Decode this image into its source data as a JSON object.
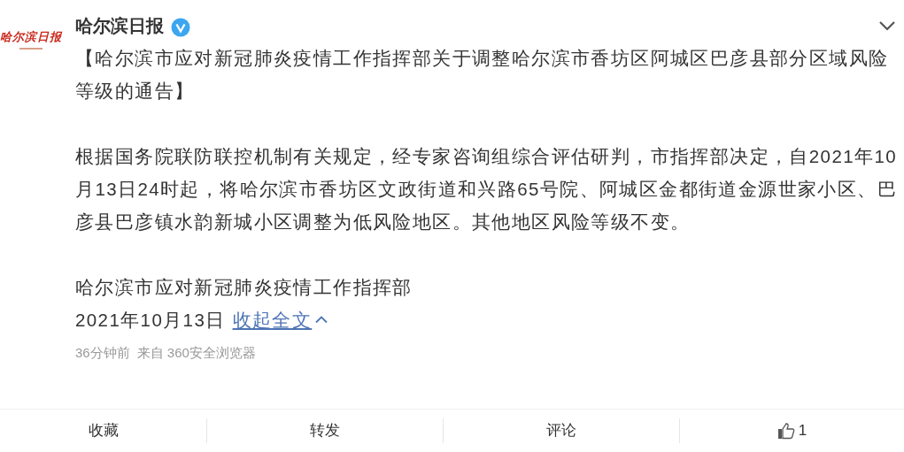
{
  "author": {
    "name": "哈尔滨日报",
    "verified": true,
    "logo_text": "哈尔滨日报"
  },
  "post": {
    "title": "【哈尔滨市应对新冠肺炎疫情工作指挥部关于调整哈尔滨市香坊区阿城区巴彦县部分区域风险等级的通告】",
    "body": "根据国务院联防联控机制有关规定，经专家咨询组综合评估研判，市指挥部决定，自2021年10月13日24时起，将哈尔滨市香坊区文政街道和兴路65号院、阿城区金都街道金源世家小区、巴彦县巴彦镇水韵新城小区调整为低风险地区。其他地区风险等级不变。",
    "signature": "哈尔滨市应对新冠肺炎疫情工作指挥部",
    "date": "2021年10月13日",
    "collapse_link": "收起全文",
    "time": "36分钟前",
    "source": "来自 360安全浏览器"
  },
  "actions": [
    {
      "kind": "text",
      "label": "收藏"
    },
    {
      "kind": "text",
      "label": "转发"
    },
    {
      "kind": "text",
      "label": "评论"
    },
    {
      "kind": "like",
      "label": "1"
    }
  ]
}
